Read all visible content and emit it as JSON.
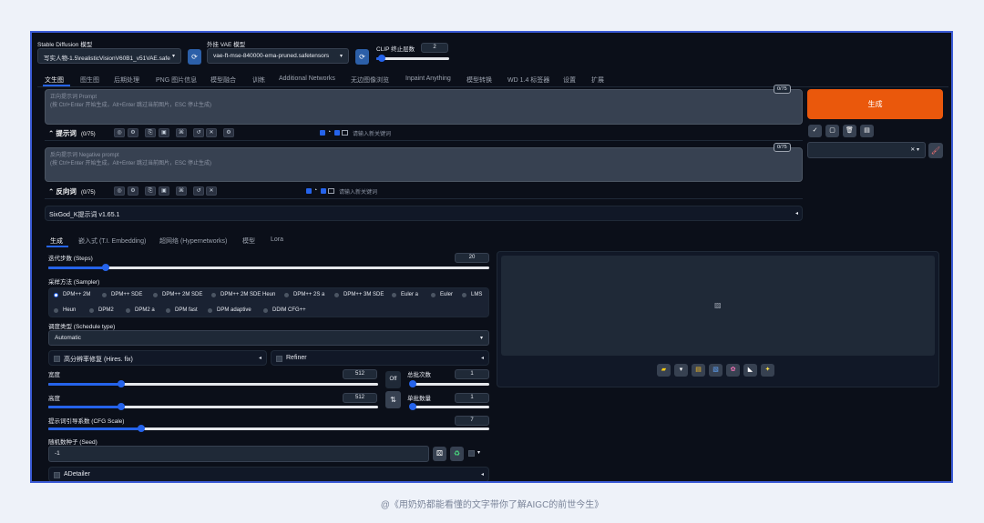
{
  "top": {
    "sd_model_label": "Stable Diffusion 模型",
    "sd_model_value": "写实人物-1.5\\realisticVisionV60B1_v51VAE.safe",
    "vae_label": "外挂 VAE 模型",
    "vae_value": "vae-ft-mse-840000-ema-pruned.safetensors",
    "clip_label": "CLIP 终止层数",
    "clip_value": "2",
    "clip_level": 0.08
  },
  "tabs": [
    "文生图",
    "图生图",
    "后期处理",
    "PNG 图片信息",
    "模型融合",
    "训练",
    "Additional Networks",
    "无边图像浏览",
    "Inpaint Anything",
    "模型转换",
    "WD 1.4 标签器",
    "设置",
    "扩展"
  ],
  "prompt": {
    "placeholder_line1": "正向提示词 Prompt",
    "placeholder_line2": "(按 Ctrl+Enter 开始生成，Alt+Enter 跳过当前图片，ESC 停止生成)",
    "counter": "0/75",
    "title": "提示词",
    "count": "(0/75)",
    "keyword_placeholder": "请输入新关键词"
  },
  "negative": {
    "placeholder_line1": "反向提示词 Negative prompt",
    "placeholder_line2": "(按 Ctrl+Enter 开始生成，Alt+Enter 跳过当前图片，ESC 停止生成)",
    "counter": "0/75",
    "title": "反向词",
    "count": "(0/75)",
    "keyword_placeholder": "请输入新关键词"
  },
  "sixgod": {
    "label": "SixGod_K提示词 v1.65.1"
  },
  "generate_label": "生成",
  "subtabs": [
    "生成",
    "嵌入式 (T.I. Embedding)",
    "超网络 (Hypernetworks)",
    "模型",
    "Lora"
  ],
  "steps": {
    "label": "迭代步数 (Steps)",
    "value": "20",
    "level": 0.13
  },
  "sampler": {
    "label": "采样方法 (Sampler)",
    "row1": [
      "DPM++ 2M",
      "DPM++ SDE",
      "DPM++ 2M SDE",
      "DPM++ 2M SDE Heun",
      "DPM++ 2S a",
      "DPM++ 3M SDE",
      "Euler a",
      "Euler",
      "LMS"
    ],
    "row2": [
      "Heun",
      "DPM2",
      "DPM2 a",
      "DPM fast",
      "DPM adaptive",
      "DDIM CFG++"
    ],
    "selected": "DPM++ 2M"
  },
  "schedule": {
    "label": "调度类型 (Schedule type)",
    "value": "Automatic"
  },
  "hires": {
    "label": "高分辨率修复 (Hires. fix)"
  },
  "refiner": {
    "label": "Refiner"
  },
  "width": {
    "label": "宽度",
    "value": "512",
    "level": 0.22
  },
  "height": {
    "label": "高度",
    "value": "512",
    "level": 0.22
  },
  "batch_count": {
    "label": "总批次数",
    "value": "1",
    "level": 0.0
  },
  "batch_size": {
    "label": "单批数量",
    "value": "1",
    "level": 0.0
  },
  "off_label": "Off",
  "cfg": {
    "label": "提示词引导系数 (CFG Scale)",
    "value": "7",
    "level": 0.21
  },
  "seed": {
    "label": "随机数种子 (Seed)",
    "value": "-1"
  },
  "adetailer": {
    "label": "ADetailer"
  },
  "caption": "@《用奶奶都能看懂的文字带你了解AIGC的前世今生》",
  "colors": {
    "accent": "#2563eb",
    "generate": "#ea580c",
    "frame": "#3b5bd6"
  }
}
